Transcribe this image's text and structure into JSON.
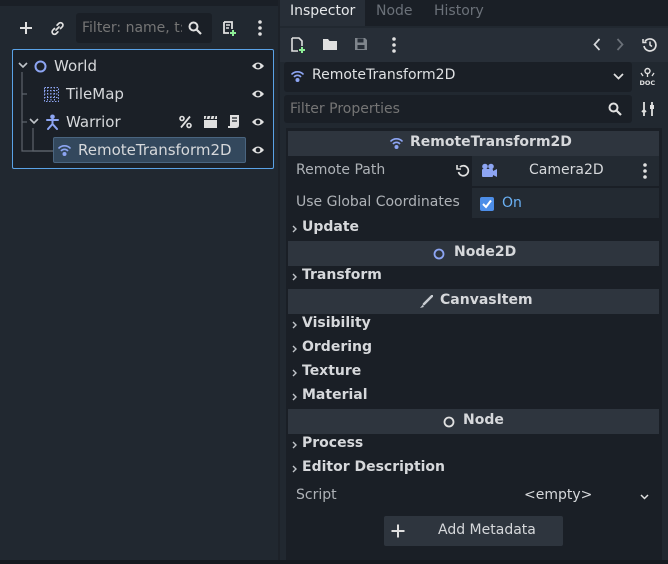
{
  "colors": {
    "accent": "#5aa2e6",
    "node_blue": "#8da5f3",
    "canvas_green": "#8eef97",
    "check_blue": "#4d8ee8"
  },
  "scene": {
    "filter_placeholder": "Filter: name, t:t",
    "toolbar_icons": [
      "add-node-icon",
      "link-icon",
      "search-icon",
      "script-add-icon",
      "kebab-menu-icon"
    ],
    "tree": [
      {
        "label": "World",
        "icon": "node2d-circle-icon",
        "expanded": true,
        "visible": true
      },
      {
        "label": "TileMap",
        "icon": "tilemap-grid-icon",
        "visible": true
      },
      {
        "label": "Warrior",
        "icon": "character-icon",
        "expanded": true,
        "visible": true,
        "badges": [
          "percent-icon",
          "clapperboard-icon",
          "script-icon"
        ]
      },
      {
        "label": "RemoteTransform2D",
        "icon": "remote-transform-icon",
        "selected": true,
        "visible": true
      }
    ]
  },
  "inspector": {
    "tabs": [
      "Inspector",
      "Node",
      "History"
    ],
    "active_tab": "Inspector",
    "node_name": "RemoteTransform2D",
    "filter_placeholder": "Filter Properties",
    "categories": [
      {
        "title": "RemoteTransform2D",
        "icon": "remote-transform-icon"
      },
      {
        "title": "Node2D",
        "icon": "node2d-circle-icon"
      },
      {
        "title": "CanvasItem",
        "icon": "brush-icon"
      },
      {
        "title": "Node",
        "icon": "node-circle-icon"
      }
    ],
    "props": {
      "remote_path": {
        "label": "Remote Path",
        "value": "Camera2D"
      },
      "use_global": {
        "label": "Use Global Coordinates",
        "value": "On",
        "checked": true
      },
      "script": {
        "label": "Script",
        "value": "<empty>"
      }
    },
    "sections": {
      "update": "Update",
      "transform": "Transform",
      "visibility": "Visibility",
      "ordering": "Ordering",
      "texture": "Texture",
      "material": "Material",
      "process": "Process",
      "editor_description": "Editor Description"
    },
    "add_metadata": "Add Metadata"
  }
}
